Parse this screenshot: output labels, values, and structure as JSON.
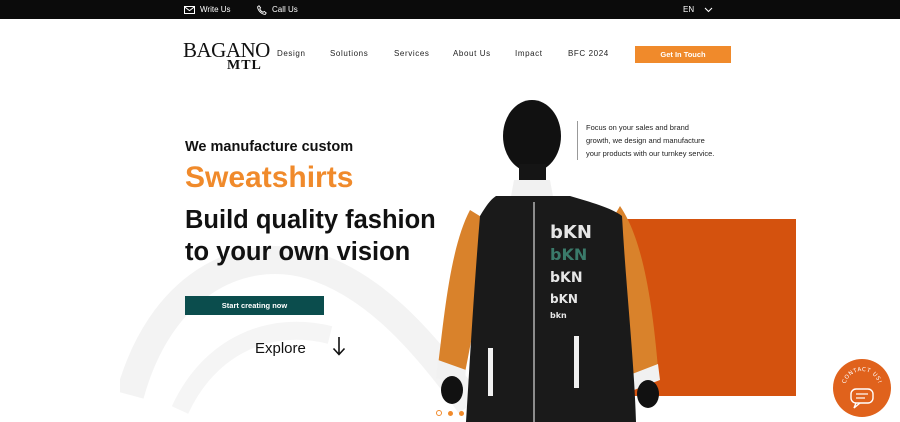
{
  "topbar": {
    "write_label": "Write Us",
    "call_label": "Call Us",
    "language": "EN"
  },
  "header": {
    "logo_word": "BAGANO",
    "logo_sub": "MTL",
    "nav": [
      "Design",
      "Solutions",
      "Services",
      "About Us",
      "Impact",
      "BFC 2024"
    ],
    "cta_label": "Get In Touch"
  },
  "hero": {
    "subtitle": "We manufacture custom",
    "product": "Sweatshirts",
    "title_line1": "Build quality fashion",
    "title_line2": "to your own vision",
    "start_button": "Start creating now",
    "explore_label": "Explore",
    "tagline_line1": "Focus on your sales and brand",
    "tagline_line2": "growth, we design and manufacture",
    "tagline_line3": "your products with our turnkey service."
  },
  "garment": {
    "print_text": [
      "bKN",
      "bKN",
      "bKN",
      "bKN",
      "bkn"
    ]
  },
  "slider": {
    "slides": 3,
    "active_index": 0
  },
  "contact_fab": {
    "label": "CONTACT US!"
  },
  "colors": {
    "accent_orange": "#f08a2b",
    "deep_orange": "#d4520e",
    "teal": "#0b4d4d",
    "topbar": "#0b0b0b"
  }
}
